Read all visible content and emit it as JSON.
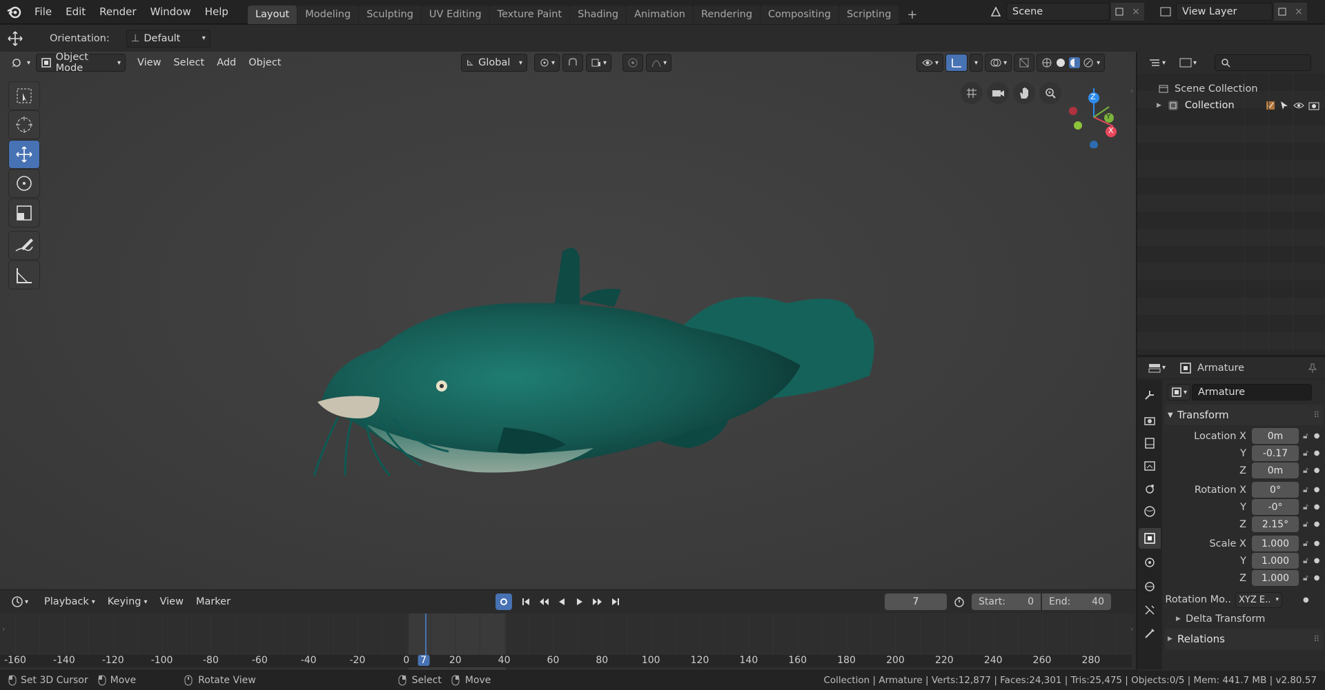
{
  "topbar": {
    "menu": [
      "File",
      "Edit",
      "Render",
      "Window",
      "Help"
    ],
    "workspaces": [
      "Layout",
      "Modeling",
      "Sculpting",
      "UV Editing",
      "Texture Paint",
      "Shading",
      "Animation",
      "Rendering",
      "Compositing",
      "Scripting"
    ],
    "active_workspace": "Layout",
    "scene": "Scene",
    "view_layer": "View Layer"
  },
  "toolheader": {
    "orientation_label": "Orientation:",
    "orientation_value": "Default"
  },
  "viewport_header": {
    "mode": "Object Mode",
    "menus": [
      "View",
      "Select",
      "Add",
      "Object"
    ],
    "transform_orientation": "Global"
  },
  "outliner": {
    "root": "Scene Collection",
    "child": "Collection"
  },
  "properties": {
    "header_object": "Armature",
    "object_name": "Armature",
    "transform_title": "Transform",
    "location_label": "Location X",
    "rotation_label": "Rotation X",
    "scale_label": "Scale X",
    "y_label": "Y",
    "z_label": "Z",
    "location": [
      "0m",
      "-0.17",
      "0m"
    ],
    "rotation": [
      "0°",
      "-0°",
      "2.15°"
    ],
    "scale": [
      "1.000",
      "1.000",
      "1.000"
    ],
    "rotation_mode_label": "Rotation Mo..",
    "rotation_mode_value": "XYZ E..",
    "delta_transform": "Delta Transform",
    "relations": "Relations"
  },
  "timeline": {
    "menus": [
      "Playback",
      "Keying",
      "View",
      "Marker"
    ],
    "current_frame": "7",
    "start_label": "Start:",
    "start": "0",
    "end_label": "End:",
    "end": "40",
    "ruler": [
      "-160",
      "-140",
      "-120",
      "-100",
      "-80",
      "-60",
      "-40",
      "-20",
      "0",
      "7",
      "20",
      "40",
      "60",
      "80",
      "100",
      "120",
      "140",
      "160",
      "180",
      "200",
      "220",
      "240",
      "260",
      "280"
    ]
  },
  "statusbar": {
    "hints": [
      "Set 3D Cursor",
      "Move",
      "Rotate View",
      "Select",
      "Move"
    ],
    "stats": "Collection | Armature | Verts:12,877 | Faces:24,301 | Tris:25,475 | Objects:0/5 | Mem: 441.7 MB | v2.80.57"
  },
  "gizmo": {
    "x": "X",
    "y": "Y",
    "z": "Z"
  },
  "colors": {
    "accent": "#4772b3",
    "panel": "#2b2b2b",
    "fish": "#1e6b62"
  }
}
